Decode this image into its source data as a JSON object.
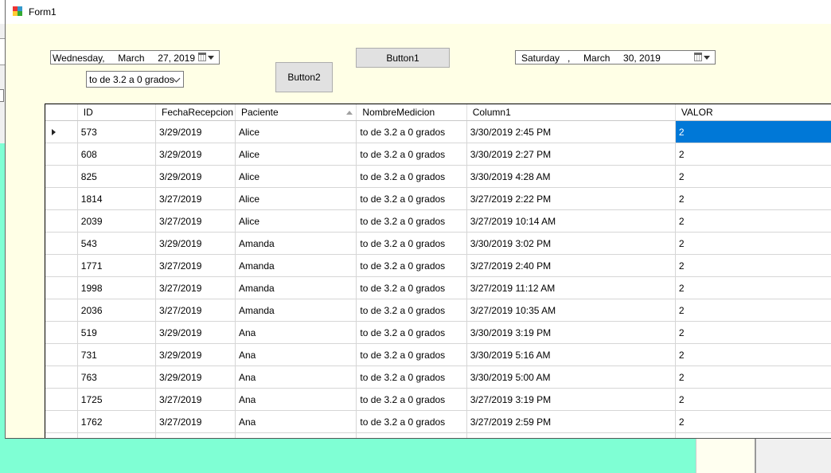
{
  "window": {
    "title": "Form1"
  },
  "controls": {
    "date_picker_1": "Wednesday,     March     27, 2019",
    "date_picker_2": "Saturday   ,     March     30, 2019",
    "combo_value": "to de 3.2 a 0 grados",
    "button1_label": "Button1",
    "button2_label": "Button2"
  },
  "grid": {
    "headers": [
      "ID",
      "FechaRecepcion",
      "Paciente",
      "NombreMedicion",
      "Column1",
      "VALOR"
    ],
    "sorted_column": "Paciente",
    "selection_color": "#0078d7",
    "rows": [
      [
        "573",
        "3/29/2019",
        "Alice",
        "to de 3.2 a 0 grados",
        "3/30/2019 2:45 PM",
        "2"
      ],
      [
        "608",
        "3/29/2019",
        "Alice",
        "to de 3.2 a 0 grados",
        "3/30/2019 2:27 PM",
        "2"
      ],
      [
        "825",
        "3/29/2019",
        "Alice",
        "to de 3.2 a 0 grados",
        "3/30/2019 4:28 AM",
        "2"
      ],
      [
        "1814",
        "3/27/2019",
        "Alice",
        "to de 3.2 a 0 grados",
        "3/27/2019 2:22 PM",
        "2"
      ],
      [
        "2039",
        "3/27/2019",
        "Alice",
        "to de 3.2 a 0 grados",
        "3/27/2019 10:14 AM",
        "2"
      ],
      [
        "543",
        "3/29/2019",
        "Amanda",
        "to de 3.2 a 0 grados",
        "3/30/2019 3:02 PM",
        "2"
      ],
      [
        "1771",
        "3/27/2019",
        "Amanda",
        "to de 3.2 a 0 grados",
        "3/27/2019 2:40 PM",
        "2"
      ],
      [
        "1998",
        "3/27/2019",
        "Amanda",
        "to de 3.2 a 0 grados",
        "3/27/2019 11:12 AM",
        "2"
      ],
      [
        "2036",
        "3/27/2019",
        "Amanda",
        "to de 3.2 a 0 grados",
        "3/27/2019 10:35 AM",
        "2"
      ],
      [
        "519",
        "3/29/2019",
        "Ana",
        "to de 3.2 a 0 grados",
        "3/30/2019 3:19 PM",
        "2"
      ],
      [
        "731",
        "3/29/2019",
        "Ana",
        "to de 3.2 a 0 grados",
        "3/30/2019 5:16 AM",
        "2"
      ],
      [
        "763",
        "3/29/2019",
        "Ana",
        "to de 3.2 a 0 grados",
        "3/30/2019 5:00 AM",
        "2"
      ],
      [
        "1725",
        "3/27/2019",
        "Ana",
        "to de 3.2 a 0 grados",
        "3/27/2019 3:19 PM",
        "2"
      ],
      [
        "1762",
        "3/27/2019",
        "Ana",
        "to de 3.2 a 0 grados",
        "3/27/2019 2:59 PM",
        "2"
      ]
    ]
  }
}
